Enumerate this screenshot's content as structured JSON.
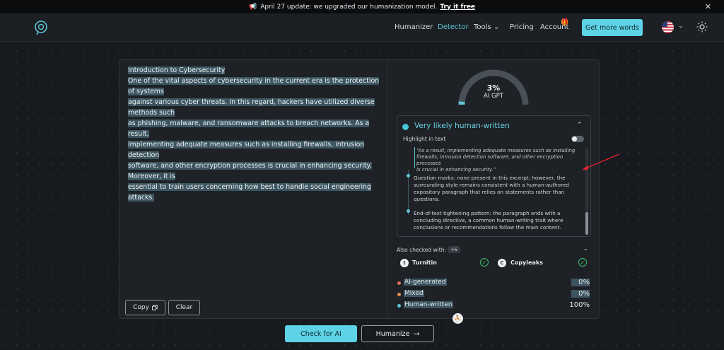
{
  "banner": {
    "text": "April 27 update: we upgraded our humanization model.",
    "link": "Try it free",
    "close": "✕"
  },
  "nav": {
    "items": [
      {
        "label": "Humanizer"
      },
      {
        "label": "Detector"
      },
      {
        "label": "Tools"
      },
      {
        "label": "Pricing"
      },
      {
        "label": "Account"
      }
    ],
    "tools_chevron": "⌄",
    "cta": "Get more words",
    "lang_chevron": "⌄"
  },
  "editor": {
    "title": "Introduction to Cybersecurity",
    "lines": [
      "One of the vital aspects of cybersecurity in the current era is the protection of systems",
      "against various cyber threats. In this regard, hackers have utilized diverse methods such",
      "as phishing, malware, and ransomware attacks to breach networks. As a result,",
      "implementing adequate measures such as installing firewalls, intrusion detection",
      "software, and other encryption processes is crucial in enhancing security. Moreover, it is",
      "essential to train users concerning how best to handle social engineering attacks."
    ],
    "copy_label": "Copy",
    "clear_label": "Clear"
  },
  "result": {
    "ai_percent": 3,
    "percent_label": "3%",
    "gauge_label": "AI GPT",
    "verdict": "Very likely human-written",
    "highlight_label": "Highlight in text",
    "highlight_on": false,
    "quote_lines": [
      "“As a result, implementing adequate measures such as installing",
      "firewalls, intrusion detection software, and other encryption processes",
      "is crucial in enhancing security.”"
    ],
    "point1_lines": [
      "Question marks: none present in this excerpt; however, the",
      "surrounding style remains consistent with a human-authored",
      "expository paragraph that relies on statements rather than",
      "questions."
    ],
    "point2_lines": [
      "End-of-text tightening pattern: the paragraph ends with a",
      "concluding directive, a common human-writing trait where",
      "conclusions or recommendations follow the main content."
    ]
  },
  "also_checked": {
    "label": "Also checked with:",
    "extra_count": "+6",
    "checkers": [
      {
        "name": "Turnitin",
        "logo": "t"
      },
      {
        "name": "Copyleaks",
        "logo": "C"
      }
    ]
  },
  "breakdown": [
    {
      "label": "AI-generated",
      "value": "0%",
      "color": "#e2715a"
    },
    {
      "label": "Mixed",
      "value": "0%",
      "color": "#e8925a"
    },
    {
      "label": "Human-written",
      "value": "100%",
      "color": "#5ec6d9"
    }
  ],
  "actions": {
    "check_label": "Check for AI",
    "humanize_label": "Humanize",
    "humanize_arrow": "→"
  }
}
